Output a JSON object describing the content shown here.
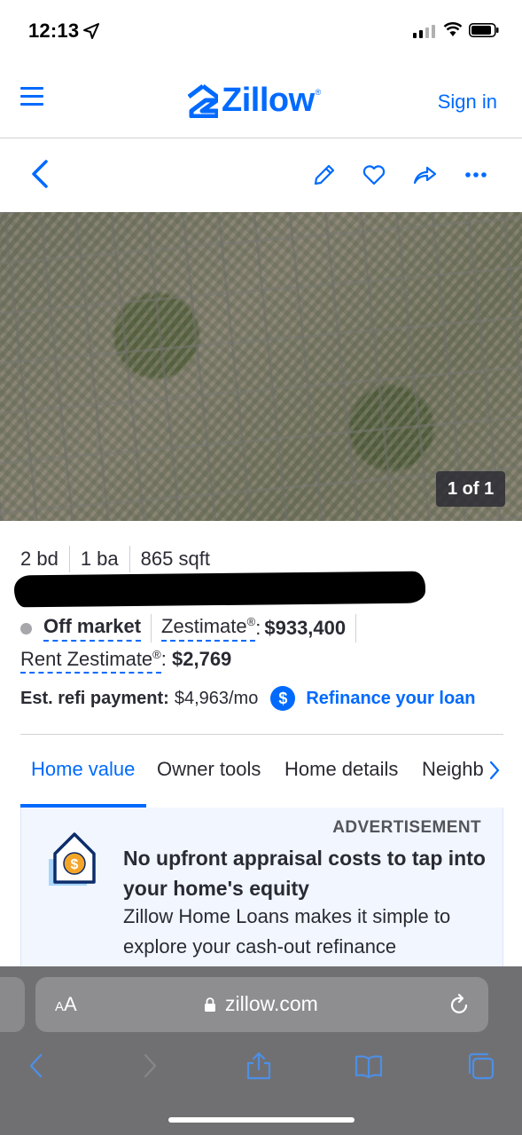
{
  "status_bar": {
    "time": "12:13"
  },
  "header": {
    "brand": "Zillow",
    "brand_reg": "®",
    "sign_in": "Sign in"
  },
  "photo": {
    "counter": "1 of 1"
  },
  "facts": {
    "beds": "2 bd",
    "baths": "1 ba",
    "sqft": "865 sqft"
  },
  "status": {
    "market": "Off market",
    "zestimate_label": "Zestimate",
    "reg": "®",
    "zestimate_value": "$933,400",
    "rent_label": "Rent Zestimate",
    "rent_value": "$2,769"
  },
  "refi": {
    "label": "Est. refi payment:",
    "value": "$4,963/mo",
    "icon_symbol": "$",
    "link": "Refinance your loan"
  },
  "tabs": [
    {
      "label": "Home value",
      "active": true
    },
    {
      "label": "Owner tools"
    },
    {
      "label": "Home details"
    },
    {
      "label": "Neighb"
    }
  ],
  "ad": {
    "label": "ADVERTISEMENT",
    "headline": "No upfront appraisal costs to tap into your home's equity",
    "body": "Zillow Home Loans makes it simple to explore your cash-out refinance"
  },
  "safari": {
    "aa_small": "A",
    "aa_large": "A",
    "url": "zillow.com"
  },
  "colors": {
    "accent": "#006aff",
    "text": "#2a2a33",
    "ad_bg": "#f1f6ff",
    "safari_bar": "#707073"
  }
}
